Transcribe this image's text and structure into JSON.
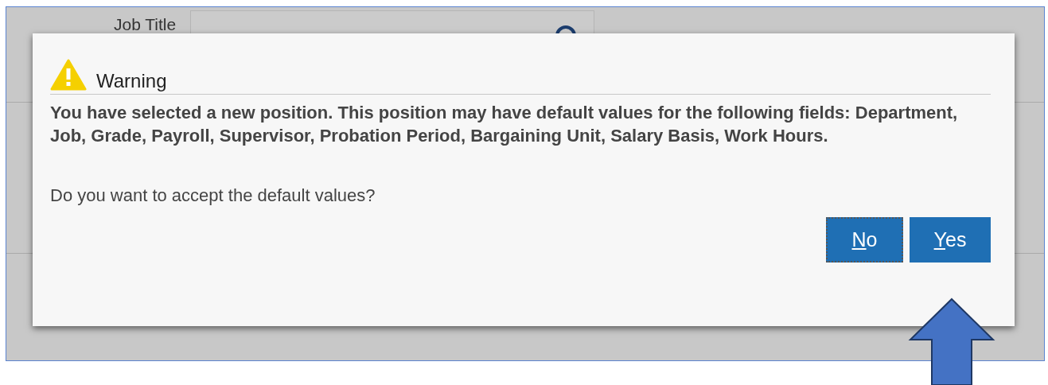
{
  "background": {
    "field_label": "Job Title"
  },
  "dialog": {
    "title": "Warning",
    "message": "You have selected a new position. This position may have default values for the following fields: Department, Job, Grade, Payroll, Supervisor, Probation Period, Bargaining Unit, Salary Basis, Work Hours.",
    "question": "Do you want to accept the default values?",
    "buttons": [
      {
        "mnemonic": "N",
        "rest": "o",
        "focused": true
      },
      {
        "mnemonic": "Y",
        "rest": "es",
        "focused": false
      }
    ]
  }
}
